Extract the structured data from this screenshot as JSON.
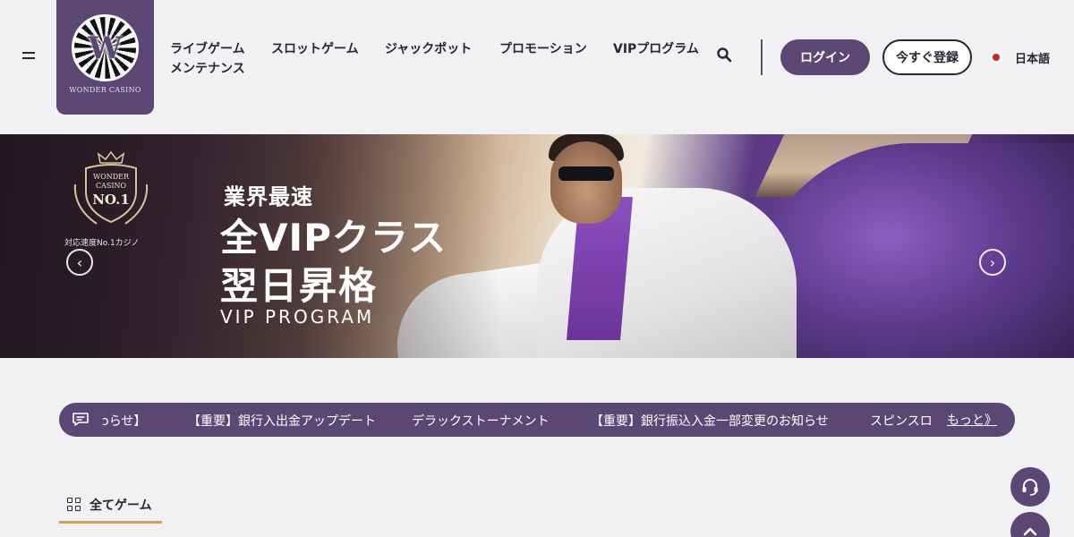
{
  "brand": {
    "logo_text": "WONDER CASINO",
    "logo_letter": "W",
    "accent": "#5c4674",
    "gold": "#c9a14f"
  },
  "nav": {
    "items": [
      {
        "label": "ライブゲーム"
      },
      {
        "label": "スロットゲーム"
      },
      {
        "label": "ジャックポット"
      },
      {
        "label": "プロモーション"
      },
      {
        "label": "VIPプログラム"
      },
      {
        "label": "メンテナンス"
      }
    ]
  },
  "header": {
    "login_label": "ログイン",
    "register_label": "今すぐ登録",
    "language": "日本語"
  },
  "banner": {
    "badge_line1": "WONDER",
    "badge_line2": "CASINO",
    "badge_rank": "NO.1",
    "badge_caption": "対応速度No.1カジノ",
    "headline_small": "業界最速",
    "headline_line1": "全VIPクラス",
    "headline_line2": "翌日昇格",
    "subtitle": "VIP PROGRAM",
    "prev_arrow": "‹",
    "next_arrow": "›"
  },
  "ticker": {
    "items": [
      "ɔらせ】",
      "【重要】銀行入出金アップデート",
      "デラックストーナメント",
      "【重要】銀行振込入金一部変更のお知らせ",
      "スピンスロ"
    ],
    "more_label": "もっと》"
  },
  "tabs": {
    "all_games_label": "全てゲーム"
  }
}
